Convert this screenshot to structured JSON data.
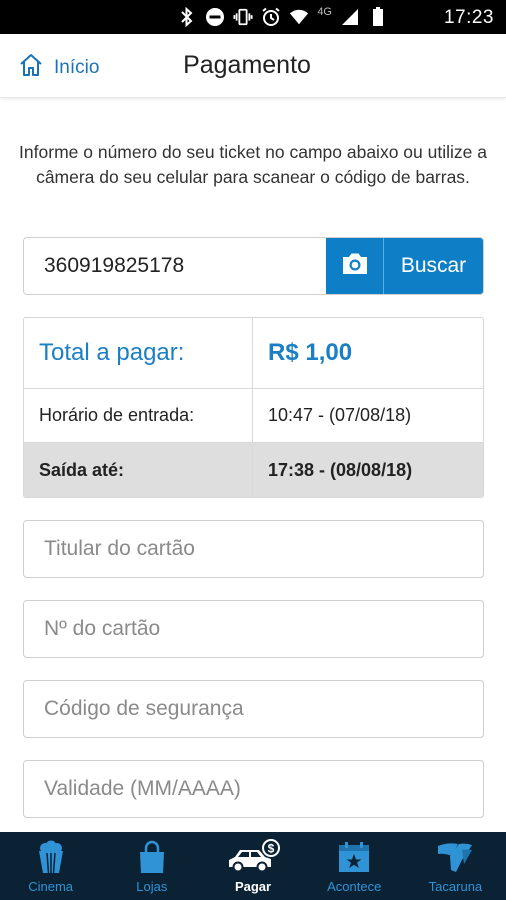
{
  "status_bar": {
    "time": "17:23",
    "network": "4G",
    "icons": [
      "bluetooth-icon",
      "do-not-disturb-icon",
      "vibrate-icon",
      "alarm-icon",
      "wifi-icon",
      "signal-icon",
      "battery-icon"
    ]
  },
  "header": {
    "back_label": "Início",
    "title": "Pagamento"
  },
  "intro_text": "Informe o número do seu ticket no campo abaixo ou utilize a câmera do seu celular para scanear o código de barras.",
  "ticket": {
    "value": "360919825178",
    "search_label": "Buscar"
  },
  "summary": {
    "total_label": "Total a pagar:",
    "total_value": "R$ 1,00",
    "entry_label": "Horário de entrada:",
    "entry_value": "10:47 - (07/08/18)",
    "exit_label": "Saída até:",
    "exit_value": "17:38 - (08/08/18)"
  },
  "form": {
    "cardholder_placeholder": "Titular do cartão",
    "card_number_placeholder": "Nº do cartão",
    "security_code_placeholder": "Código de segurança",
    "expiry_placeholder": "Validade (MM/AAAA)"
  },
  "bottom_nav": {
    "items": [
      {
        "label": "Cinema",
        "icon": "popcorn-icon",
        "active": false
      },
      {
        "label": "Lojas",
        "icon": "shopping-bag-icon",
        "active": false
      },
      {
        "label": "Pagar",
        "icon": "car-payment-icon",
        "active": true
      },
      {
        "label": "Acontece",
        "icon": "calendar-star-icon",
        "active": false
      },
      {
        "label": "Tacaruna",
        "icon": "tacaruna-logo-icon",
        "active": false
      }
    ]
  },
  "colors": {
    "accent": "#0e7fc6",
    "accent_text": "#1a7fc4",
    "nav_background": "#0b2234",
    "nav_label": "#2f93d6",
    "exit_row_background": "#dedede"
  }
}
